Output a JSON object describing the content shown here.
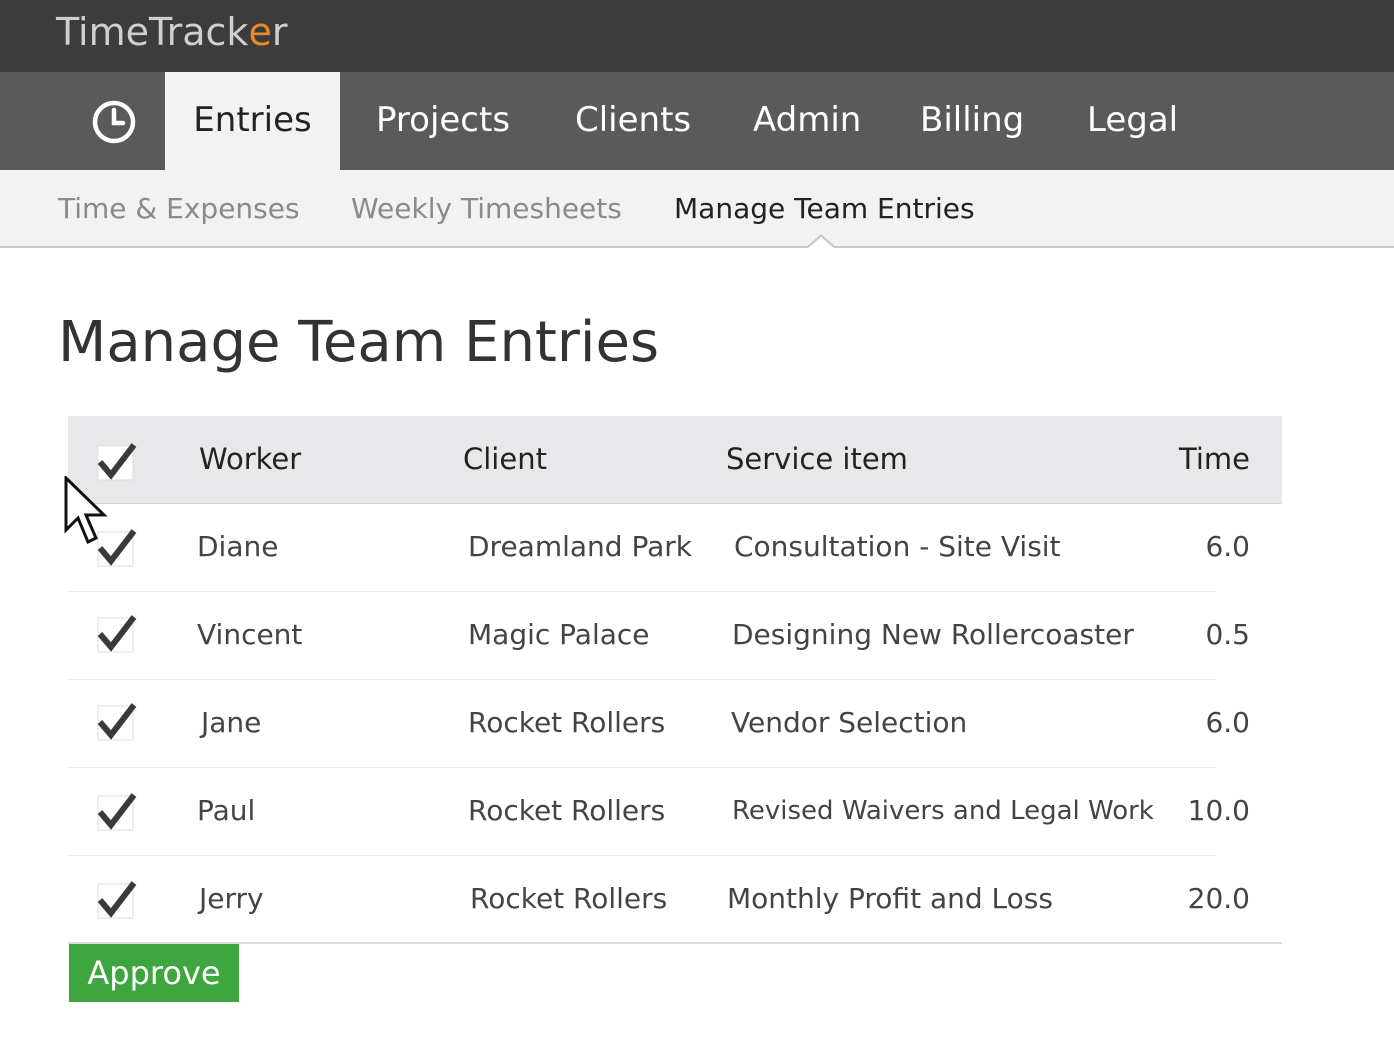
{
  "app": {
    "logo_text_before": "TimeTrack",
    "logo_text_o": "e",
    "logo_text_after": "r",
    "accent_color": "#e8892b"
  },
  "main_nav": {
    "home_icon": "clock-icon",
    "tabs": [
      {
        "label": "Entries",
        "active": true
      },
      {
        "label": "Projects",
        "active": false
      },
      {
        "label": "Clients",
        "active": false
      },
      {
        "label": "Admin",
        "active": false
      },
      {
        "label": "Billing",
        "active": false
      },
      {
        "label": "Legal",
        "active": false
      }
    ]
  },
  "sub_nav": {
    "tabs": [
      {
        "label": "Time & Expenses",
        "active": false
      },
      {
        "label": "Weekly Timesheets",
        "active": false
      },
      {
        "label": "Manage Team Entries",
        "active": true
      }
    ]
  },
  "page": {
    "title": "Manage Team Entries"
  },
  "table": {
    "columns": [
      "Worker",
      "Client",
      "Service item",
      "Time"
    ],
    "select_all_checked": true,
    "rows": [
      {
        "checked": true,
        "worker": "Diane",
        "client": "Dreamland Park",
        "service": "Consultation - Site Visit",
        "time": "6.0"
      },
      {
        "checked": true,
        "worker": "Vincent",
        "client": "Magic Palace",
        "service": "Designing New Rollercoaster",
        "time": "0.5"
      },
      {
        "checked": true,
        "worker": "Jane",
        "client": "Rocket Rollers",
        "service": "Vendor Selection",
        "time": "6.0"
      },
      {
        "checked": true,
        "worker": "Paul",
        "client": "Rocket Rollers",
        "service": "Revised Waivers and Legal Work",
        "time": "10.0"
      },
      {
        "checked": true,
        "worker": "Jerry",
        "client": "Rocket Rollers",
        "service": "Monthly Profit and Loss",
        "time": "20.0"
      }
    ]
  },
  "actions": {
    "approve_label": "Approve",
    "approve_color": "#3ea63e"
  }
}
